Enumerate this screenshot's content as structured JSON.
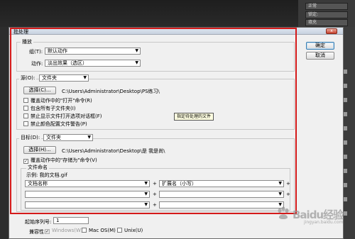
{
  "background": {
    "top_right_rows": [
      "正常",
      "锁定: ",
      "填充"
    ]
  },
  "dialog": {
    "title": "批处理",
    "close_label": "x",
    "buttons": {
      "ok": "确定",
      "cancel": "取消"
    },
    "play": {
      "title": "播放",
      "set_label": "组(T):",
      "set_value": "默认动作",
      "action_label": "动作:",
      "action_value": "淡出效果（选区）"
    },
    "source": {
      "label": "源(O):",
      "value": "文件夹",
      "choose_label": "选择(C)...",
      "path": "C:\\Users\\Administrator\\Desktop\\PS练习\\",
      "checks": [
        {
          "label": "覆盖动作中的\"打开\"命令(R)",
          "checked": false
        },
        {
          "label": "包含所有子文件夹(I)",
          "checked": false
        },
        {
          "label": "禁止显示文件打开选项对话框(F)",
          "checked": false
        },
        {
          "label": "禁止颜色配置文件警告(P)",
          "checked": false
        }
      ],
      "tooltip": "指定待处理的文件"
    },
    "destination": {
      "label": "目标(D):",
      "value": "文件夹",
      "choose_label": "选择(H)...",
      "path": "C:\\Users\\Administrator\\Desktop\\是 我是尚\\",
      "override_label": "覆盖动作中的\"存储为\"命令(V)",
      "override_checked": true
    },
    "naming": {
      "title": "文件命名",
      "example": "示例: 我的文档.gif",
      "rows": [
        [
          "文档名称",
          "扩展名（小写）"
        ],
        [
          "",
          ""
        ],
        [
          "",
          ""
        ]
      ],
      "plus": "+"
    },
    "serial": {
      "label": "起始序列号:",
      "value": "1"
    },
    "compat": {
      "label": "兼容性:",
      "windows": "Windows(W)",
      "mac": "Mac OS(M)",
      "unix": "Unix(U)"
    }
  },
  "watermark": {
    "text": "Baidu经验",
    "sub": "jingyan.baidu.com"
  }
}
